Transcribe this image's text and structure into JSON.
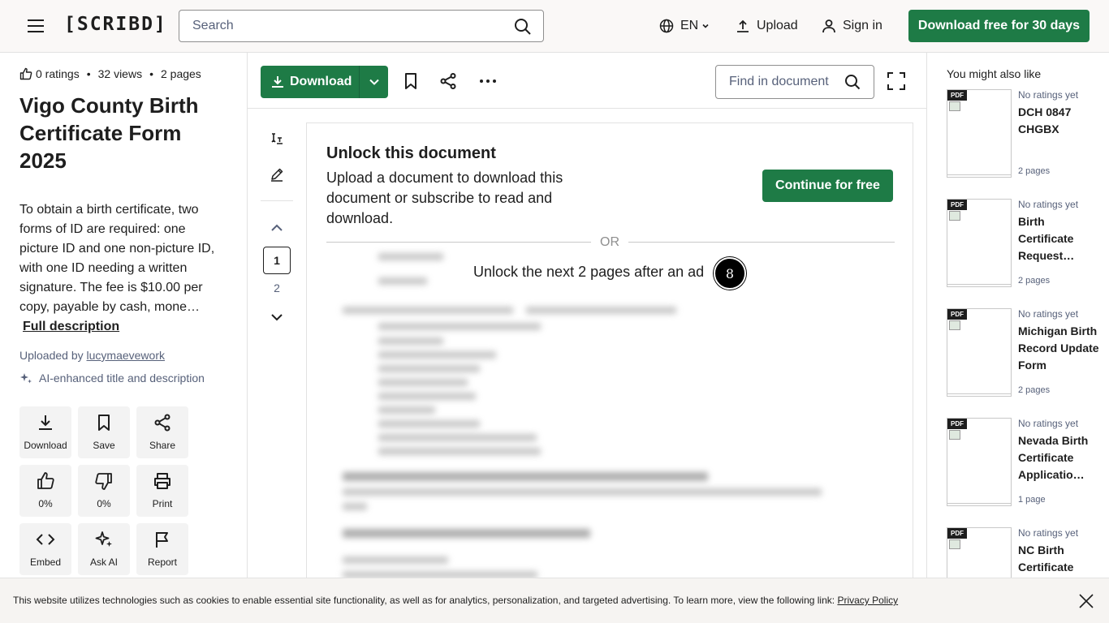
{
  "header": {
    "logo": "[SCRIBD]",
    "search_placeholder": "Search",
    "language": "EN",
    "upload": "Upload",
    "sign_in": "Sign in",
    "download_free": "Download free for 30 days"
  },
  "doc": {
    "ratings": "0 ratings",
    "views": "32 views",
    "pages": "2 pages",
    "title": "Vigo County Birth Certificate Form 2025",
    "description": "To obtain a birth certificate, two forms of ID are required: one picture ID and one non-picture ID, with one ID needing a written signature. The fee is $10.00 per copy, payable by cash, mone…",
    "full_description": "Full description",
    "uploaded_by_prefix": "Uploaded by",
    "uploader": "lucymaevework",
    "ai_note": "AI-enhanced title and description"
  },
  "actions": [
    {
      "label": "Download",
      "icon": "download-icon"
    },
    {
      "label": "Save",
      "icon": "bookmark-icon"
    },
    {
      "label": "Share",
      "icon": "share-icon"
    },
    {
      "label": "0%",
      "icon": "thumbs-up-icon"
    },
    {
      "label": "0%",
      "icon": "thumbs-down-icon"
    },
    {
      "label": "Print",
      "icon": "print-icon"
    },
    {
      "label": "Embed",
      "icon": "embed-icon"
    },
    {
      "label": "Ask AI",
      "icon": "sparkle-icon"
    },
    {
      "label": "Report",
      "icon": "flag-icon"
    }
  ],
  "toolbar": {
    "download": "Download",
    "find_placeholder": "Find in document"
  },
  "pager": {
    "current": "1",
    "next": "2"
  },
  "unlock": {
    "heading": "Unlock this document",
    "body": "Upload a document to download this document or subscribe to read and download.",
    "continue": "Continue for free",
    "or": "OR",
    "ad_text": "Unlock the next 2 pages after an ad",
    "timer": "8"
  },
  "rail": {
    "heading": "You might also like",
    "cards": [
      {
        "badge": "PDF",
        "rating": "No ratings yet",
        "title": "DCH 0847 CHGBX",
        "pages": "2 pages"
      },
      {
        "badge": "PDF",
        "rating": "No ratings yet",
        "title": "Birth Certificate Request…",
        "pages": "2 pages"
      },
      {
        "badge": "PDF",
        "rating": "No ratings yet",
        "title": "Michigan Birth Record Update Form",
        "pages": "2 pages"
      },
      {
        "badge": "PDF",
        "rating": "No ratings yet",
        "title": "Nevada Birth Certificate Applicatio…",
        "pages": "1 page"
      },
      {
        "badge": "PDF",
        "rating": "No ratings yet",
        "title": "NC Birth Certificate",
        "pages": ""
      }
    ]
  },
  "cookie": {
    "text": "This website utilizes technologies such as cookies to enable essential site functionality, as well as for analytics, personalization, and targeted advertising. To learn more, view the following link:",
    "link": "Privacy Policy"
  },
  "colors": {
    "brand_green": "#1e7b46",
    "header_bg": "#faf8f7"
  }
}
